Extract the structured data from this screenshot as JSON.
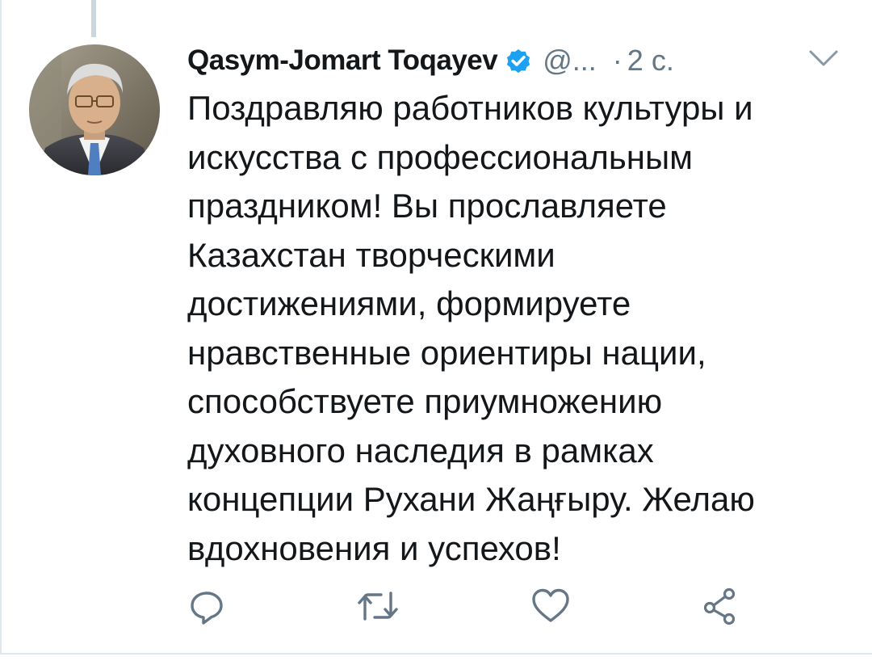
{
  "tweet": {
    "author_name": "Qasym-Jomart Toqayev",
    "handle": "@...",
    "time_separator": "·",
    "time": "2 с.",
    "verified": true,
    "text_lines": [
      "Поздравляю работников культуры и",
      "искусства с профессиональным",
      "праздником! Вы прославляете",
      "Казахстан творческими",
      "достижениями, формируете",
      "нравственные ориентиры нации,",
      "способствуете приумножению",
      "духовного наследия в рамках",
      "концепции Рухани Жаңғыру. Желаю",
      "вдохновения и успехов!"
    ]
  },
  "icons": {
    "verified": "verified-badge-icon",
    "caret": "chevron-down-icon",
    "reply": "reply-icon",
    "retweet": "retweet-icon",
    "like": "heart-icon",
    "share": "share-icon"
  },
  "colors": {
    "text": "#14171a",
    "secondary": "#657786",
    "verified_blue": "#1da1f2",
    "border": "#e1e8ed",
    "thread_line": "#ccd6dd"
  }
}
